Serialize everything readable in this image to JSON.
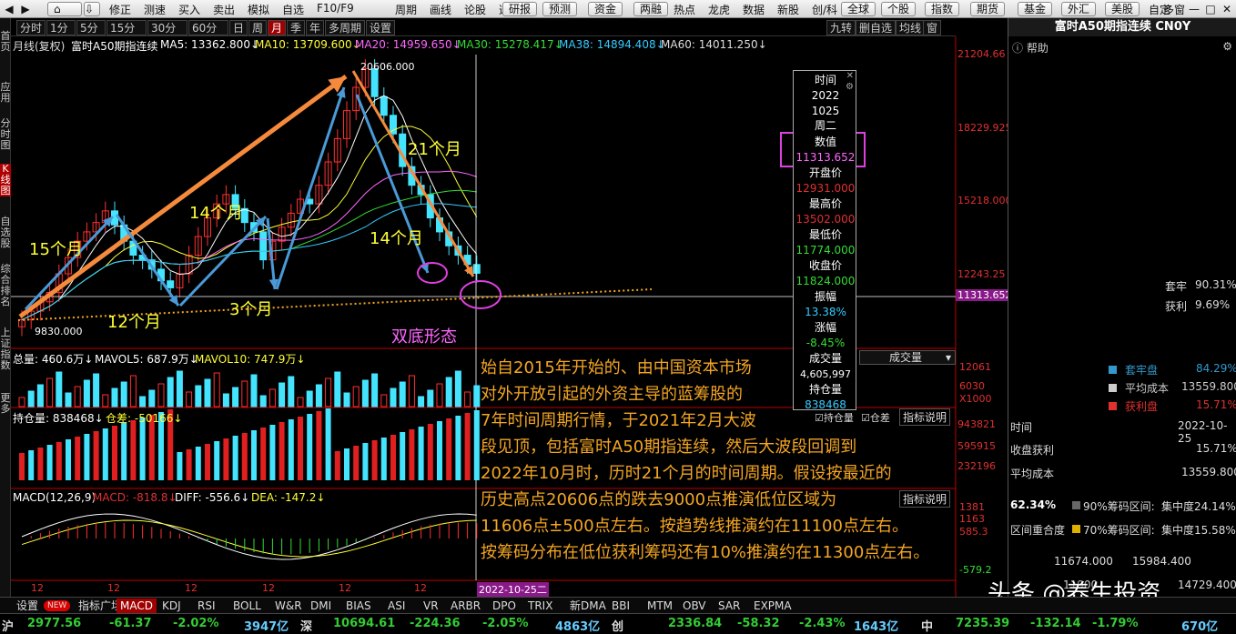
{
  "toolbar": {
    "items": [
      "分时",
      "1分",
      "5分",
      "15分",
      "30分",
      "60分",
      "日",
      "周",
      "月",
      "季",
      "年",
      "多周期",
      "设置"
    ],
    "menu": [
      "修正",
      "测速",
      "买入",
      "卖出",
      "模拟",
      "自选",
      "F10/F9",
      "周期",
      "画线",
      "论股",
      "选股",
      "研报",
      "预测",
      "资金",
      "两融",
      "热点",
      "龙虎",
      "数据",
      "新股",
      "创/科"
    ],
    "right_buttons": [
      "全球",
      "个股",
      "指数",
      "期货",
      "基金",
      "外汇",
      "美股",
      "自定",
      "多窗"
    ]
  },
  "left_tabs": [
    "首页",
    "应用",
    "分时图",
    "K线图",
    "自选股",
    "综合排名",
    "上证指数",
    "更多"
  ],
  "period": {
    "tabs": [
      "分时",
      "1分",
      "5分",
      "15分",
      "30分",
      "60分",
      "日",
      "周",
      "月",
      "季",
      "年",
      "多周期",
      "设置"
    ],
    "right": [
      "九转",
      "删自选",
      "均线",
      "窗"
    ]
  },
  "main_info": {
    "label": "月线(复权)",
    "name": "富时A50期指连续",
    "ma5": "MA5: 13362.800↓",
    "ma10": "MA10: 13709.600↓",
    "ma20": "MA20: 14959.650↓",
    "ma30": "MA30: 15278.417↓",
    "ma38": "MA38: 14894.408↓",
    "ma60": "MA60: 14011.250↓"
  },
  "price_axis": [
    "21204.66",
    "18229.925",
    "15218.000",
    "12243.25",
    "11313.652"
  ],
  "peak_label": "20606.000",
  "low_label": "9830.000",
  "chart_labels": {
    "m15": "15个月",
    "m12": "12个月",
    "m14a": "14个月",
    "m3": "3个月",
    "m14b": "14个月",
    "m21": "21个月",
    "double": "双底形态"
  },
  "tooltip": {
    "time_h": "时间",
    "year": "2022",
    "date": "1025",
    "weekday": "周二",
    "value_h": "数值",
    "value": "11313.652",
    "open_h": "开盘价",
    "open": "12931.000",
    "high_h": "最高价",
    "high": "13502.000",
    "low_h": "最低价",
    "low": "11774.000",
    "close_h": "收盘价",
    "close": "11824.000",
    "amp_h": "振幅",
    "amp": "13.38%",
    "chg_h": "涨幅",
    "chg": "-8.45%",
    "vol_h": "成交量",
    "vol": "4,605,997",
    "oi_h": "持仓量",
    "oi": "838468"
  },
  "vol_info": {
    "total": "总量: 460.6万↓",
    "mavol5": "MAVOL5: 687.9万↓",
    "mavol10": "MAVOL10: 747.9万↓",
    "dropdown": "成交量"
  },
  "vol_axis": [
    "12061",
    "6030",
    "X1000"
  ],
  "oi_info": {
    "oi": "持仓量: 838468↓",
    "diff": "仓差: -50166↓",
    "chk1": "持仓量",
    "chk2": "仓差",
    "help": "指标说明"
  },
  "oi_axis": [
    "943821",
    "595915",
    "232196"
  ],
  "macd_info": {
    "macd": "MACD(12,26,9)",
    "val": "MACD: -818.8↓",
    "diff": "DIFF: -556.6↓",
    "dea": "DEA: -147.2↓",
    "help": "指标说明"
  },
  "macd_axis": [
    "1381",
    "1163",
    "585.3",
    "-579.2"
  ],
  "x_axis": [
    "12",
    "12",
    "12",
    "12",
    "12",
    "12",
    "2022-10-25二"
  ],
  "annotation": [
    "始自2015年开始的、由中国资本市场",
    "对外开放引起的外资主导的蓝筹股的",
    "7年时间周期行情，于2021年2月大波",
    "段见顶，包括富时A50期指连续，然后大波段回调到",
    "2022年10月时，历时21个月的时间周期。假设按最近的",
    "历史高点20606点的跌去9000点推演低位区域为",
    "11606点±500点左右。按趋势线推演约在11100点左右。",
    "按筹码分布在低位获利筹码还有10%推演约在11300点左右。"
  ],
  "right_panel": {
    "title": "富时A50期指连续 CN0Y",
    "help": "帮助",
    "taolao_l": "套牢",
    "taolao_v": "90.31%",
    "huoli_l": "获利",
    "huoli_v": "9.69%",
    "rows": [
      {
        "label": "套牢盘",
        "value": "84.29%",
        "color": "#3399cc"
      },
      {
        "label": "平均成本",
        "value": "13559.800",
        "color": "#cccccc"
      },
      {
        "label": "获利盘",
        "value": "15.71%",
        "color": "#e03030"
      }
    ],
    "time_l": "时间",
    "time_v": "2022-10-25",
    "close_profit_l": "收盘获利",
    "close_profit_v": "15.71%",
    "avg_cost_l": "平均成本",
    "avg_cost_v": "13559.800",
    "pct": "62.34%",
    "c90": "90%筹码区间:",
    "c90c": "集中度24.14%",
    "overlap": "区间重合度",
    "c70": "70%筹码区间:",
    "c70c": "集中度15.58%",
    "r1": "11674.000",
    "r2": "15984.400",
    "r3": "11900",
    "r4": "14729.400"
  },
  "bottom_tabs": [
    "设置",
    "NEW",
    "指标广场",
    "MACD",
    "KDJ",
    "RSI",
    "BOLL",
    "W&R",
    "DMI",
    "BIAS",
    "ASI",
    "VR",
    "ARBR",
    "DPO",
    "TRIX",
    "新DMA",
    "BBI",
    "MTM",
    "OBV",
    "SAR",
    "EXPMA"
  ],
  "ticker": [
    {
      "t": "沪",
      "c": "#ddd"
    },
    {
      "t": "2977.56",
      "c": "#3c3"
    },
    {
      "t": "-61.37",
      "c": "#3c3"
    },
    {
      "t": "-2.02%",
      "c": "#3c3"
    },
    {
      "t": "3947亿",
      "c": "#6cf"
    },
    {
      "t": "深",
      "c": "#ddd"
    },
    {
      "t": "10694.61",
      "c": "#3c3"
    },
    {
      "t": "-224.36",
      "c": "#3c3"
    },
    {
      "t": "-2.05%",
      "c": "#3c3"
    },
    {
      "t": "4863亿",
      "c": "#6cf"
    },
    {
      "t": "创",
      "c": "#ddd"
    },
    {
      "t": "2336.84",
      "c": "#3c3"
    },
    {
      "t": "-58.32",
      "c": "#3c3"
    },
    {
      "t": "-2.43%",
      "c": "#3c3"
    },
    {
      "t": "1643亿",
      "c": "#6cf"
    },
    {
      "t": "中",
      "c": "#ddd"
    },
    {
      "t": "7235.39",
      "c": "#3c3"
    },
    {
      "t": "-132.14",
      "c": "#3c3"
    },
    {
      "t": "-1.79%",
      "c": "#3c3"
    },
    {
      "t": "670亿",
      "c": "#6cf"
    }
  ],
  "watermark": "头条 @养生投资"
}
